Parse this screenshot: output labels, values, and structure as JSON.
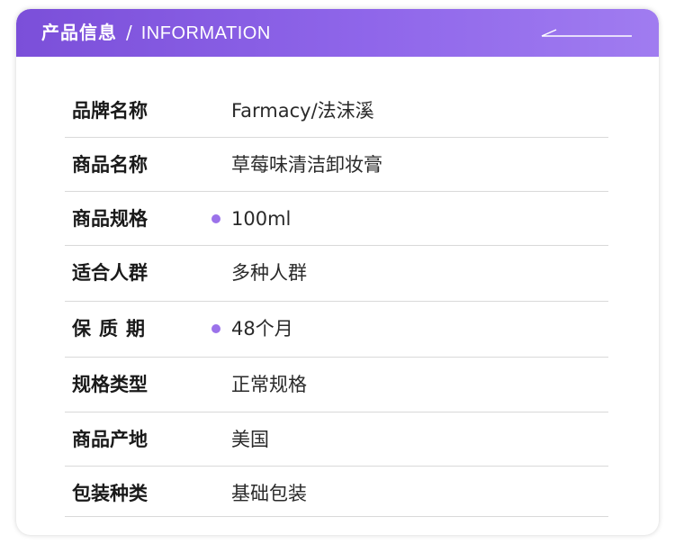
{
  "header": {
    "title_zh": "产品信息",
    "separator": "/",
    "title_en": "INFORMATION",
    "gradient_start": "#7b4fd9",
    "gradient_end": "#a07cf0",
    "deco_icon": "arrow-line-icon"
  },
  "accent_color": "#9b72ea",
  "rows": [
    {
      "label": "品牌名称",
      "value": "Farmacy/法沫溪",
      "dot": false
    },
    {
      "label": "商品名称",
      "value": "草莓味清洁卸妆膏",
      "dot": false
    },
    {
      "label": "商品规格",
      "value": "100ml",
      "dot": true
    },
    {
      "label": "适合人群",
      "value": "多种人群",
      "dot": false
    },
    {
      "label": "保质期",
      "value": "48个月",
      "dot": true
    },
    {
      "label": "规格类型",
      "value": "正常规格",
      "dot": false
    },
    {
      "label": "商品产地",
      "value": "美国",
      "dot": false
    },
    {
      "label": "包装种类",
      "value": "基础包装",
      "dot": false
    }
  ]
}
